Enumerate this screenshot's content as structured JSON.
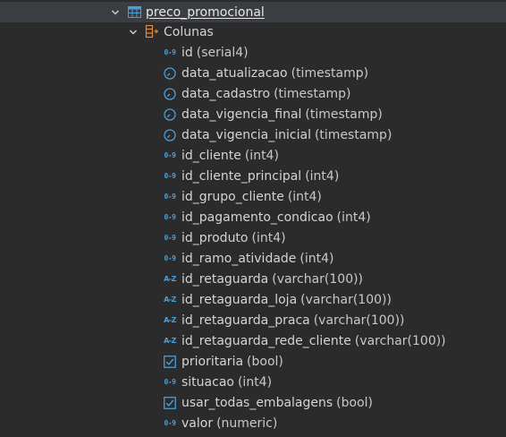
{
  "tree": {
    "table": {
      "label": "preco_promocional",
      "icon": "table-icon",
      "expanded": true
    },
    "columns_folder": {
      "label": "Colunas",
      "icon": "columns-folder-icon",
      "expanded": true
    },
    "columns": [
      {
        "name": "id",
        "type": "(serial4)",
        "icon": "numeric-icon"
      },
      {
        "name": "data_atualizacao",
        "type": "(timestamp)",
        "icon": "clock-icon"
      },
      {
        "name": "data_cadastro",
        "type": "(timestamp)",
        "icon": "clock-icon"
      },
      {
        "name": "data_vigencia_final",
        "type": "(timestamp)",
        "icon": "clock-icon"
      },
      {
        "name": "data_vigencia_inicial",
        "type": "(timestamp)",
        "icon": "clock-icon"
      },
      {
        "name": "id_cliente",
        "type": "(int4)",
        "icon": "numeric-icon"
      },
      {
        "name": "id_cliente_principal",
        "type": "(int4)",
        "icon": "numeric-icon"
      },
      {
        "name": "id_grupo_cliente",
        "type": "(int4)",
        "icon": "numeric-icon"
      },
      {
        "name": "id_pagamento_condicao",
        "type": "(int4)",
        "icon": "numeric-icon"
      },
      {
        "name": "id_produto",
        "type": "(int4)",
        "icon": "numeric-icon"
      },
      {
        "name": "id_ramo_atividade",
        "type": "(int4)",
        "icon": "numeric-icon"
      },
      {
        "name": "id_retaguarda",
        "type": "(varchar(100))",
        "icon": "text-az-icon"
      },
      {
        "name": "id_retaguarda_loja",
        "type": "(varchar(100))",
        "icon": "text-az-icon"
      },
      {
        "name": "id_retaguarda_praca",
        "type": "(varchar(100))",
        "icon": "text-az-icon"
      },
      {
        "name": "id_retaguarda_rede_cliente",
        "type": "(varchar(100))",
        "icon": "text-az-icon"
      },
      {
        "name": "prioritaria",
        "type": "(bool)",
        "icon": "checkbox-icon"
      },
      {
        "name": "situacao",
        "type": "(int4)",
        "icon": "numeric-icon"
      },
      {
        "name": "usar_todas_embalagens",
        "type": "(bool)",
        "icon": "checkbox-icon"
      },
      {
        "name": "valor",
        "type": "(numeric)",
        "icon": "numeric-icon"
      }
    ]
  },
  "colors": {
    "background": "#2b2b2b",
    "selected_row": "#3a3d41",
    "icon_blue": "#4b9fd8",
    "folder_orange": "#e08a3c",
    "text": "#d4d4d4"
  },
  "icon_glyphs": {
    "numeric": "0-9",
    "text": "A-Z"
  }
}
